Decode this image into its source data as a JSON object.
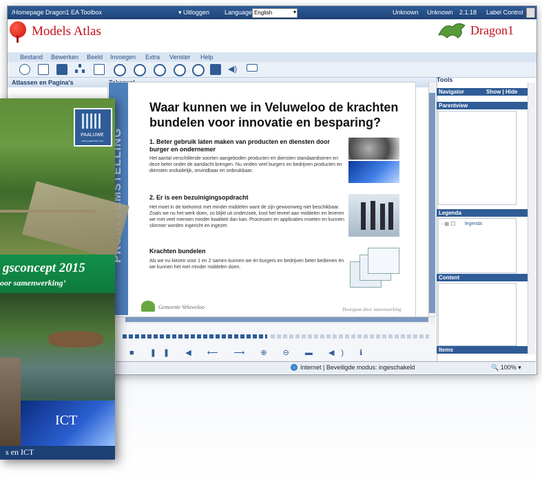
{
  "topbar": {
    "homepage_link": "/Homepage Dragon1 EA Toolbox",
    "logout_label": "Uitloggen",
    "language_label": "Language :",
    "language_value": "English",
    "user1": "Unknown",
    "user2": "Unknown",
    "version": "2.1.18",
    "label_control": "Label Control"
  },
  "header": {
    "app_title": "Models Atlas",
    "brand_title": "Dragon1"
  },
  "menu": [
    "Bestand",
    "Bewerken",
    "Beeld",
    "Invoegen",
    "Extra",
    "Venster",
    "Help"
  ],
  "panes": {
    "left_title": "Atlassen en Pagina's",
    "center_title": "Tekenvel",
    "tools_title": "Tools",
    "navigator_label": "Navigator",
    "navigator_actions": "Show | Hide",
    "parentview_label": "Parentview",
    "legenda_label": "Legenda",
    "legenda_item": "legenda",
    "content_label": "Content",
    "items_label": "Items"
  },
  "slide": {
    "band_text": "PROBLEEMSTELLING",
    "title": "Waar kunnen we in Veluweloo de krachten bundelen voor innovatie en besparing?",
    "sections": [
      {
        "heading": "1. Beter gebruik laten maken van producten en diensten door burger en ondernemer",
        "body": "Het aantal verschillende soorten aangeboden producten en diensten standaardiseren en deze beter onder de aandacht brengen. Nu vinden veel burgers en bedrijven producten en diensten onduidelijk, onvindbaar en onbruikbaar."
      },
      {
        "heading": "2. Er is een bezuinigingsopdracht",
        "body": "Het moet in de toekomst met minder middelen want de zijn gewoonweg niet beschikbaar. Zoals we nu het werk doen, zo blijkt uit onderzoek, kost het teveel aan middelen en leveren we met veel mensen minder kwaliteit dan kan. Processen en applicaties moeten en kunnen slimmer worden ingericht en ingezet."
      },
      {
        "heading": "Krachten bundelen",
        "body": "Als we nu kiezen voor 1 en 2 samen kunnen we én burgers en bedrijven beter bedienen én we kunnen het met minder middelen doen."
      }
    ],
    "footer_left": "Gemeente Veluweloo",
    "footer_right": "Doorgaan door samenwerking"
  },
  "status": {
    "zone_text": "Internet | Beveiligde modus: ingeschakeld",
    "zoom": "100%"
  },
  "book": {
    "logo_text": "PAALUWE",
    "logo_url": "www.paaluwe.info",
    "title": "gsconcept 2015",
    "subtitle": "oor samenwerking’",
    "ict": "ICT",
    "footer": "s en ICT"
  },
  "colors": {
    "accent_red": "#c3101d",
    "window_blue": "#2f5c96",
    "band_blue": "#4e80bc",
    "book_green": "#0d7a3c"
  },
  "icons": [
    "globe-icon",
    "new-page-icon",
    "save-icon",
    "hierarchy-icon",
    "image-icon",
    "shape-icon",
    "shape-icon",
    "shape-icon",
    "shape-icon",
    "refresh-icon",
    "comment-icon",
    "sound-icon",
    "presentation-icon"
  ]
}
